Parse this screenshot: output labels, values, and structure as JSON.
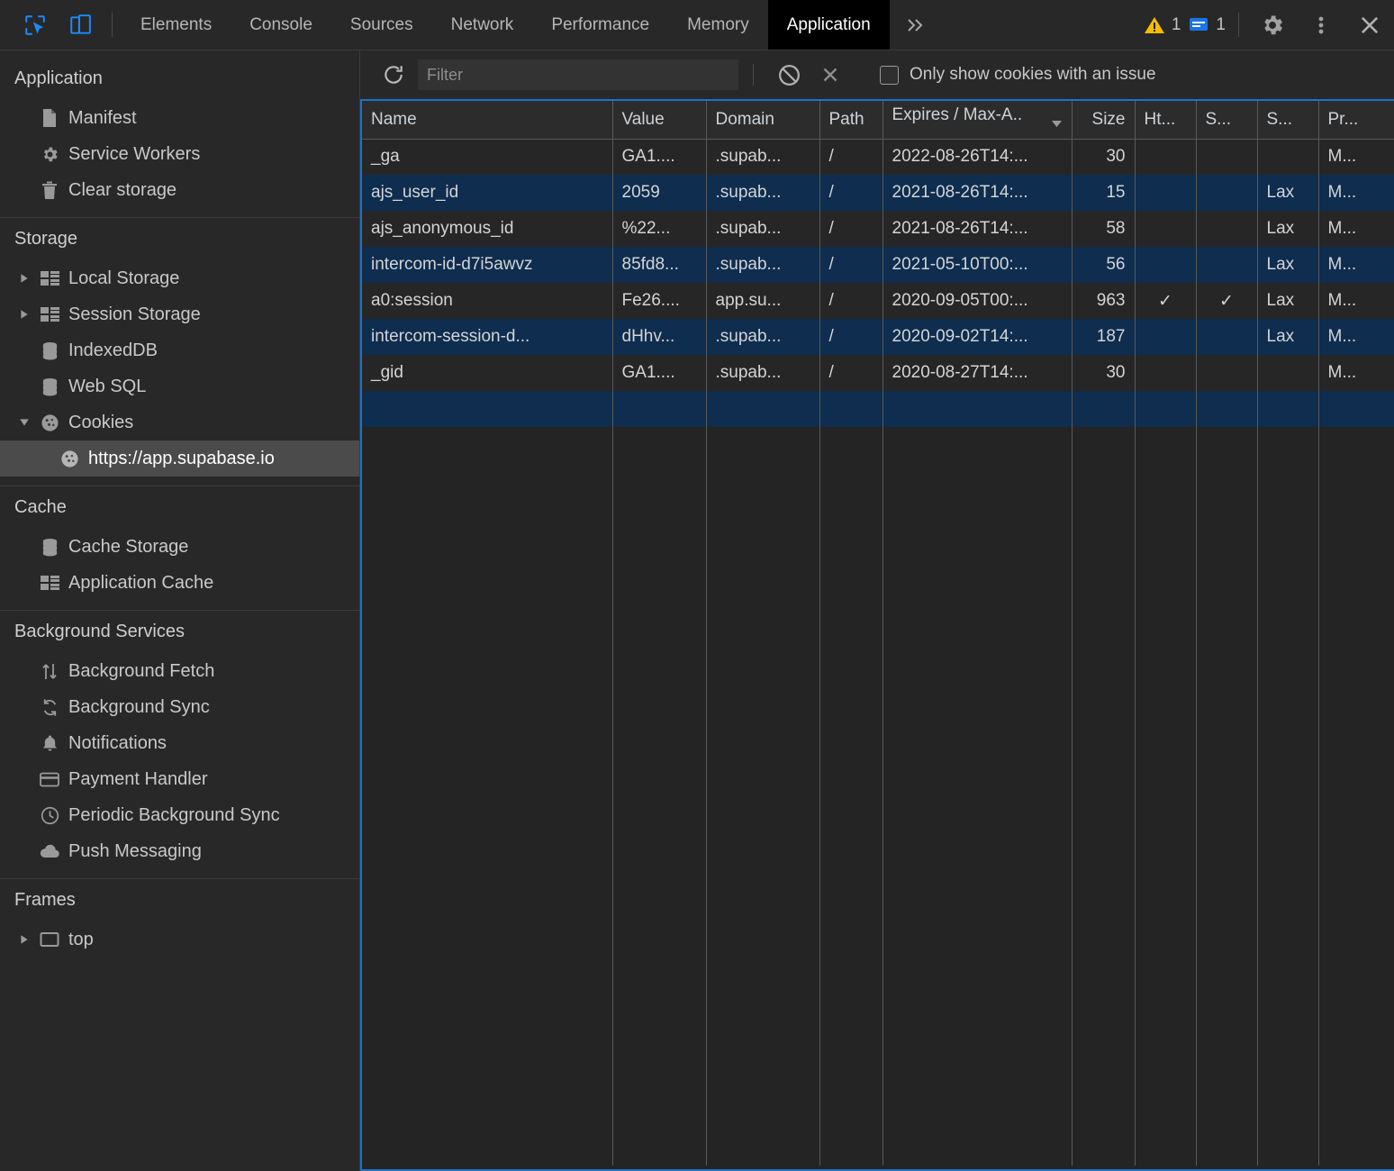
{
  "tabbar": {
    "tools": [
      {
        "name": "inspect-element-icon",
        "title": "Inspect element"
      },
      {
        "name": "device-toolbar-icon",
        "title": "Toggle device toolbar"
      }
    ],
    "tabs": [
      {
        "label": "Elements",
        "active": false
      },
      {
        "label": "Console",
        "active": false
      },
      {
        "label": "Sources",
        "active": false
      },
      {
        "label": "Network",
        "active": false
      },
      {
        "label": "Performance",
        "active": false
      },
      {
        "label": "Memory",
        "active": false
      },
      {
        "label": "Application",
        "active": true
      }
    ],
    "more_tabs_icon": "chevron-double-right-icon",
    "warnings": {
      "icon": "warning-triangle-icon",
      "count": "1",
      "color": "#fbbc04"
    },
    "messages": {
      "icon": "message-bubble-icon",
      "count": "1",
      "color": "#1a73e8"
    },
    "settings_icon": "gear-icon",
    "more_options_icon": "kebab-menu-icon",
    "close_icon": "close-icon"
  },
  "sidebar": {
    "sections": [
      {
        "title": "Application",
        "items": [
          {
            "label": "Manifest",
            "icon": "document-icon",
            "arrow": "none",
            "indent": 1,
            "selected": false
          },
          {
            "label": "Service Workers",
            "icon": "gear-icon",
            "arrow": "none",
            "indent": 1,
            "selected": false
          },
          {
            "label": "Clear storage",
            "icon": "trash-icon",
            "arrow": "none",
            "indent": 1,
            "selected": false
          }
        ]
      },
      {
        "title": "Storage",
        "items": [
          {
            "label": "Local Storage",
            "icon": "table-grid-icon",
            "arrow": "collapsed",
            "indent": 0,
            "selected": false
          },
          {
            "label": "Session Storage",
            "icon": "table-grid-icon",
            "arrow": "collapsed",
            "indent": 0,
            "selected": false
          },
          {
            "label": "IndexedDB",
            "icon": "database-icon",
            "arrow": "none",
            "indent": 0,
            "selected": false
          },
          {
            "label": "Web SQL",
            "icon": "database-icon",
            "arrow": "none",
            "indent": 0,
            "selected": false
          },
          {
            "label": "Cookies",
            "icon": "cookie-icon",
            "arrow": "expanded",
            "indent": 0,
            "selected": false
          },
          {
            "label": "https://app.supabase.io",
            "icon": "cookie-icon",
            "arrow": "none",
            "indent": 2,
            "selected": true
          }
        ]
      },
      {
        "title": "Cache",
        "items": [
          {
            "label": "Cache Storage",
            "icon": "database-icon",
            "arrow": "none",
            "indent": 1,
            "selected": false
          },
          {
            "label": "Application Cache",
            "icon": "table-grid-icon",
            "arrow": "none",
            "indent": 1,
            "selected": false
          }
        ]
      },
      {
        "title": "Background Services",
        "items": [
          {
            "label": "Background Fetch",
            "icon": "up-down-arrows-icon",
            "arrow": "none",
            "indent": 1,
            "selected": false
          },
          {
            "label": "Background Sync",
            "icon": "sync-icon",
            "arrow": "none",
            "indent": 1,
            "selected": false
          },
          {
            "label": "Notifications",
            "icon": "bell-icon",
            "arrow": "none",
            "indent": 1,
            "selected": false
          },
          {
            "label": "Payment Handler",
            "icon": "credit-card-icon",
            "arrow": "none",
            "indent": 1,
            "selected": false
          },
          {
            "label": "Periodic Background Sync",
            "icon": "clock-icon",
            "arrow": "none",
            "indent": 1,
            "selected": false
          },
          {
            "label": "Push Messaging",
            "icon": "cloud-icon",
            "arrow": "none",
            "indent": 1,
            "selected": false
          }
        ]
      },
      {
        "title": "Frames",
        "items": [
          {
            "label": "top",
            "icon": "frame-icon",
            "arrow": "collapsed",
            "indent": 0,
            "selected": false
          }
        ]
      }
    ]
  },
  "toolbar": {
    "refresh_icon": "refresh-icon",
    "filter_placeholder": "Filter",
    "filter_value": "",
    "clear_all_icon": "block-clear-icon",
    "delete_icon": "x-delete-icon",
    "only_issues_label": "Only show cookies with an issue",
    "only_issues_checked": false
  },
  "table": {
    "columns": [
      {
        "label": "Name",
        "align": "left"
      },
      {
        "label": "Value",
        "align": "left"
      },
      {
        "label": "Domain",
        "align": "left"
      },
      {
        "label": "Path",
        "align": "left"
      },
      {
        "label": "Expires / Max-A..",
        "align": "left",
        "sorted": "desc"
      },
      {
        "label": "Size",
        "align": "right"
      },
      {
        "label": "Ht...",
        "align": "left"
      },
      {
        "label": "S...",
        "align": "left"
      },
      {
        "label": "S...",
        "align": "left"
      },
      {
        "label": "Pr...",
        "align": "left"
      }
    ],
    "rows": [
      {
        "name": "_ga",
        "value": "GA1....",
        "domain": ".supab...",
        "path": "/",
        "expires": "2022-08-26T14:...",
        "size": "30",
        "httponly": "",
        "secure": "",
        "samesite": "",
        "priority": "M..."
      },
      {
        "name": "ajs_user_id",
        "value": "2059",
        "domain": ".supab...",
        "path": "/",
        "expires": "2021-08-26T14:...",
        "size": "15",
        "httponly": "",
        "secure": "",
        "samesite": "Lax",
        "priority": "M..."
      },
      {
        "name": "ajs_anonymous_id",
        "value": "%22...",
        "domain": ".supab...",
        "path": "/",
        "expires": "2021-08-26T14:...",
        "size": "58",
        "httponly": "",
        "secure": "",
        "samesite": "Lax",
        "priority": "M..."
      },
      {
        "name": "intercom-id-d7i5awvz",
        "value": "85fd8...",
        "domain": ".supab...",
        "path": "/",
        "expires": "2021-05-10T00:...",
        "size": "56",
        "httponly": "",
        "secure": "",
        "samesite": "Lax",
        "priority": "M..."
      },
      {
        "name": "a0:session",
        "value": "Fe26....",
        "domain": "app.su...",
        "path": "/",
        "expires": "2020-09-05T00:...",
        "size": "963",
        "httponly": "✓",
        "secure": "✓",
        "samesite": "Lax",
        "priority": "M..."
      },
      {
        "name": "intercom-session-d...",
        "value": "dHhv...",
        "domain": ".supab...",
        "path": "/",
        "expires": "2020-09-02T14:...",
        "size": "187",
        "httponly": "",
        "secure": "",
        "samesite": "Lax",
        "priority": "M..."
      },
      {
        "name": "_gid",
        "value": "GA1....",
        "domain": ".supab...",
        "path": "/",
        "expires": "2020-08-27T14:...",
        "size": "30",
        "httponly": "",
        "secure": "",
        "samesite": "",
        "priority": "M..."
      },
      {
        "name": "",
        "value": "",
        "domain": "",
        "path": "",
        "expires": "",
        "size": "",
        "httponly": "",
        "secure": "",
        "samesite": "",
        "priority": ""
      }
    ]
  }
}
